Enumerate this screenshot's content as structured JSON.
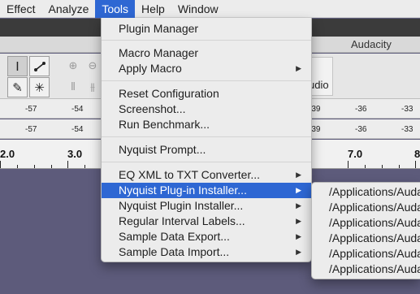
{
  "menubar": {
    "items": [
      "Effect",
      "Analyze",
      "Tools",
      "Help",
      "Window"
    ],
    "active": "Tools"
  },
  "window": {
    "title": "Audacity",
    "audio_label": "udio"
  },
  "toolbar": {
    "tools": [
      {
        "name": "selection-tool",
        "icon": "I-beam"
      },
      {
        "name": "envelope-tool",
        "icon": "envelope"
      },
      {
        "name": "draw-tool",
        "icon": "pencil"
      },
      {
        "name": "multi-tool",
        "icon": "asterisk"
      }
    ]
  },
  "meters": {
    "recording_ticks": [
      "-57",
      "-54",
      "-39",
      "-36",
      "-33"
    ],
    "playback_ticks": [
      "-57",
      "-54",
      "-39",
      "-36",
      "-33"
    ]
  },
  "ruler": {
    "labels": [
      "2.0",
      "3.0",
      "7.0",
      "8"
    ]
  },
  "tools_menu": {
    "groups": [
      [
        {
          "label": "Plugin Manager",
          "submenu": false
        }
      ],
      [
        {
          "label": "Macro Manager",
          "submenu": false
        },
        {
          "label": "Apply Macro",
          "submenu": true
        }
      ],
      [
        {
          "label": "Reset Configuration",
          "submenu": false
        },
        {
          "label": "Screenshot...",
          "submenu": false
        },
        {
          "label": "Run Benchmark...",
          "submenu": false
        }
      ],
      [
        {
          "label": "Nyquist Prompt...",
          "submenu": false
        }
      ],
      [
        {
          "label": "EQ XML to TXT Converter...",
          "submenu": true
        },
        {
          "label": "Nyquist Plug-in Installer...",
          "submenu": true,
          "highlighted": true
        },
        {
          "label": "Nyquist Plugin Installer...",
          "submenu": true
        },
        {
          "label": "Regular Interval Labels...",
          "submenu": true
        },
        {
          "label": "Sample Data Export...",
          "submenu": true
        },
        {
          "label": "Sample Data Import...",
          "submenu": true
        }
      ]
    ]
  },
  "submenu": {
    "items": [
      "/Applications/Audacity",
      "/Applications/Audacity",
      "/Applications/Audacity",
      "/Applications/Audacity",
      "/Applications/Audacity",
      "/Applications/Audacity"
    ]
  },
  "colors": {
    "highlight": "#2e67d3",
    "menu_bg": "#ececec",
    "track_area": "#5d5b7b"
  }
}
